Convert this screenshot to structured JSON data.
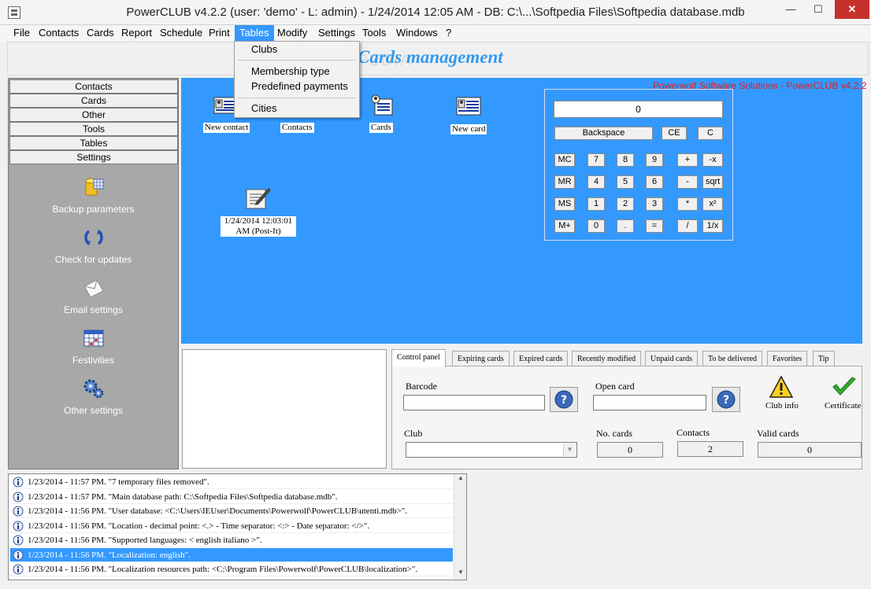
{
  "window": {
    "title": "PowerCLUB v4.2.2  (user: 'demo'  - L: admin) - 1/24/2014 12:05 AM - DB: C:\\...\\Softpedia Files\\Softpedia database.mdb",
    "minimize": "—",
    "maximize": "☐",
    "close": "✕"
  },
  "menubar": {
    "items": [
      "File",
      "Contacts",
      "Cards",
      "Report",
      "Schedule",
      "Print",
      "Tables",
      "Modify",
      "Settings",
      "Tools",
      "Windows",
      "?"
    ]
  },
  "tables_menu": {
    "items": [
      "Clubs",
      "Membership type",
      "Predefined payments",
      "Cities"
    ]
  },
  "heading": "Cards management",
  "watermark": "SOFTPEDIA",
  "watermark_url": "www.softpedia.com",
  "sidebar": {
    "headers": [
      "Contacts",
      "Cards",
      "Other",
      "Tools",
      "Tables",
      "Settings"
    ],
    "items": [
      {
        "label": "Backup parameters",
        "icon": "database-icon"
      },
      {
        "label": "Check for updates",
        "icon": "refresh-icon"
      },
      {
        "label": "Email settings",
        "icon": "envelope-icon"
      },
      {
        "label": "Festivities",
        "icon": "calendar-icon"
      },
      {
        "label": "Other settings",
        "icon": "gears-icon"
      }
    ]
  },
  "desktop": {
    "company": "Powerwolf Software Solutions - PowerCLUB v4.2.2",
    "icons": [
      {
        "label": "New contact",
        "icon": "contact-card-icon"
      },
      {
        "label": "Contacts",
        "icon": "contact-card-icon"
      },
      {
        "label": "Cards",
        "icon": "cards-icon"
      },
      {
        "label": "New card",
        "icon": "id-card-icon"
      }
    ],
    "postit": {
      "label_line1": "1/24/2014 12:03:01",
      "label_line2": "AM (Post-It)",
      "icon": "note-pen-icon"
    }
  },
  "calculator": {
    "display": "0",
    "top_buttons": [
      "Backspace",
      "CE",
      "C"
    ],
    "rows": [
      [
        "MC",
        "7",
        "8",
        "9",
        "+",
        "-x"
      ],
      [
        "MR",
        "4",
        "5",
        "6",
        "-",
        "sqrt"
      ],
      [
        "MS",
        "1",
        "2",
        "3",
        "*",
        "x²"
      ],
      [
        "M+",
        "0",
        ".",
        "=",
        "/",
        "1/x"
      ]
    ]
  },
  "tabs": [
    "Control panel",
    "Expiring cards",
    "Expired cards",
    "Recently modified",
    "Unpaid cards",
    "To be delivered",
    "Favorites",
    "Tip"
  ],
  "control_panel": {
    "barcode_label": "Barcode",
    "open_card_label": "Open card",
    "club_info": "Club info",
    "certificate": "Certificate",
    "club_label": "Club",
    "no_cards_label": "No. cards",
    "no_cards_value": "0",
    "contacts_label": "Contacts",
    "contacts_value": "2",
    "valid_cards_label": "Valid cards",
    "valid_cards_value": "0"
  },
  "log": [
    "1/23/2014 - 11:57 PM. \"7 temporary files removed\".",
    "1/23/2014 - 11:57 PM. \"Main database path: C:\\Softpedia Files\\Softpedia database.mdb\".",
    "1/23/2014 - 11:56 PM. \"User database: <C:\\Users\\IEUser\\Documents\\Powerwolf\\PowerCLUB\\utenti.mdb>\".",
    "1/23/2014 - 11:56 PM. \"Location - decimal point: <.> - Time separator: <:> - Date separator: </>\".",
    "1/23/2014 - 11:56 PM. \"Supported languages: < english italiano >\".",
    "1/23/2014 - 11:56 PM. \"Localization: english\".",
    "1/23/2014 - 11:56 PM. \"Localization resources path: <C:\\Program Files\\Powerwolf\\PowerCLUB\\localization>\"."
  ],
  "log_selected_index": 5,
  "colors": {
    "desktop": "#3399ff",
    "sidebar": "#a8a8a8",
    "heading": "#3399ee",
    "company": "#e02020",
    "close": "#c7312b"
  }
}
